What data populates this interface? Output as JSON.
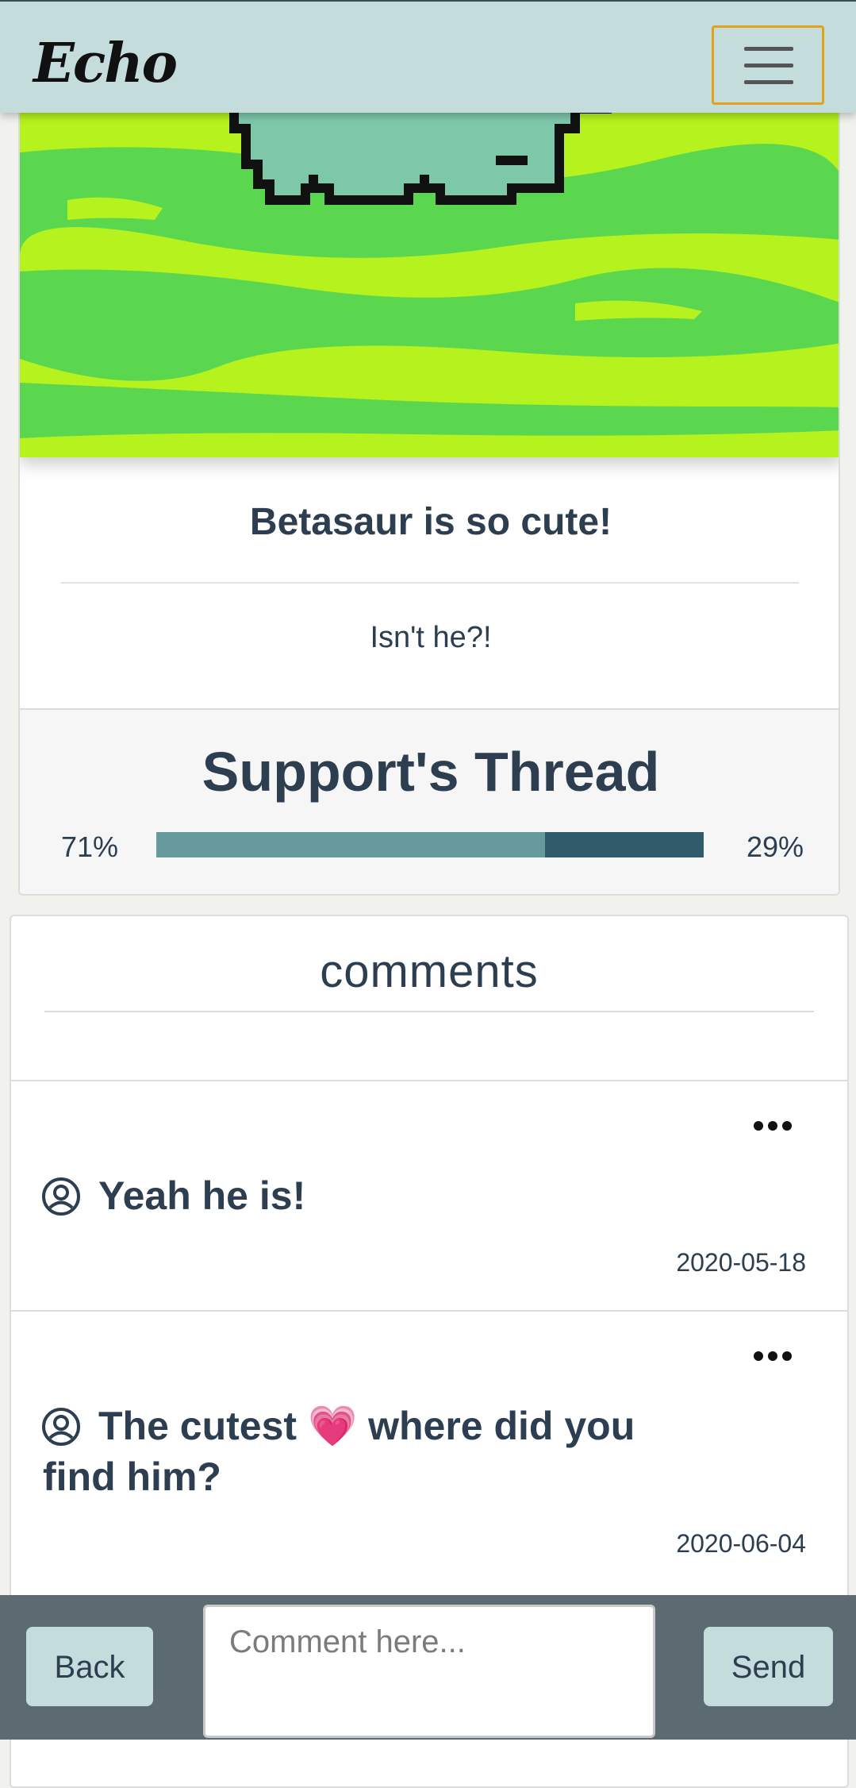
{
  "app": {
    "brand": "Echo"
  },
  "post": {
    "image_alt": "pixel art dinosaur on grass",
    "title": "Betasaur is so cute!",
    "body": "Isn't he?!"
  },
  "thread": {
    "title": "Support's Thread",
    "left_percent_label": "71%",
    "right_percent_label": "29%",
    "support_fraction": 0.71,
    "colors": {
      "support": "#66999b",
      "oppose": "#2f5b6b"
    }
  },
  "comments": {
    "heading": "comments",
    "items": [
      {
        "text": "Yeah he is!",
        "date": "2020-05-18",
        "icon": "user-circle-icon"
      },
      {
        "text": "The cutest 💗 where did you find him?",
        "date": "2020-06-04",
        "icon": "user-circle-icon"
      }
    ]
  },
  "bottom_bar": {
    "back_label": "Back",
    "send_label": "Send",
    "input_placeholder": "Comment here..."
  }
}
